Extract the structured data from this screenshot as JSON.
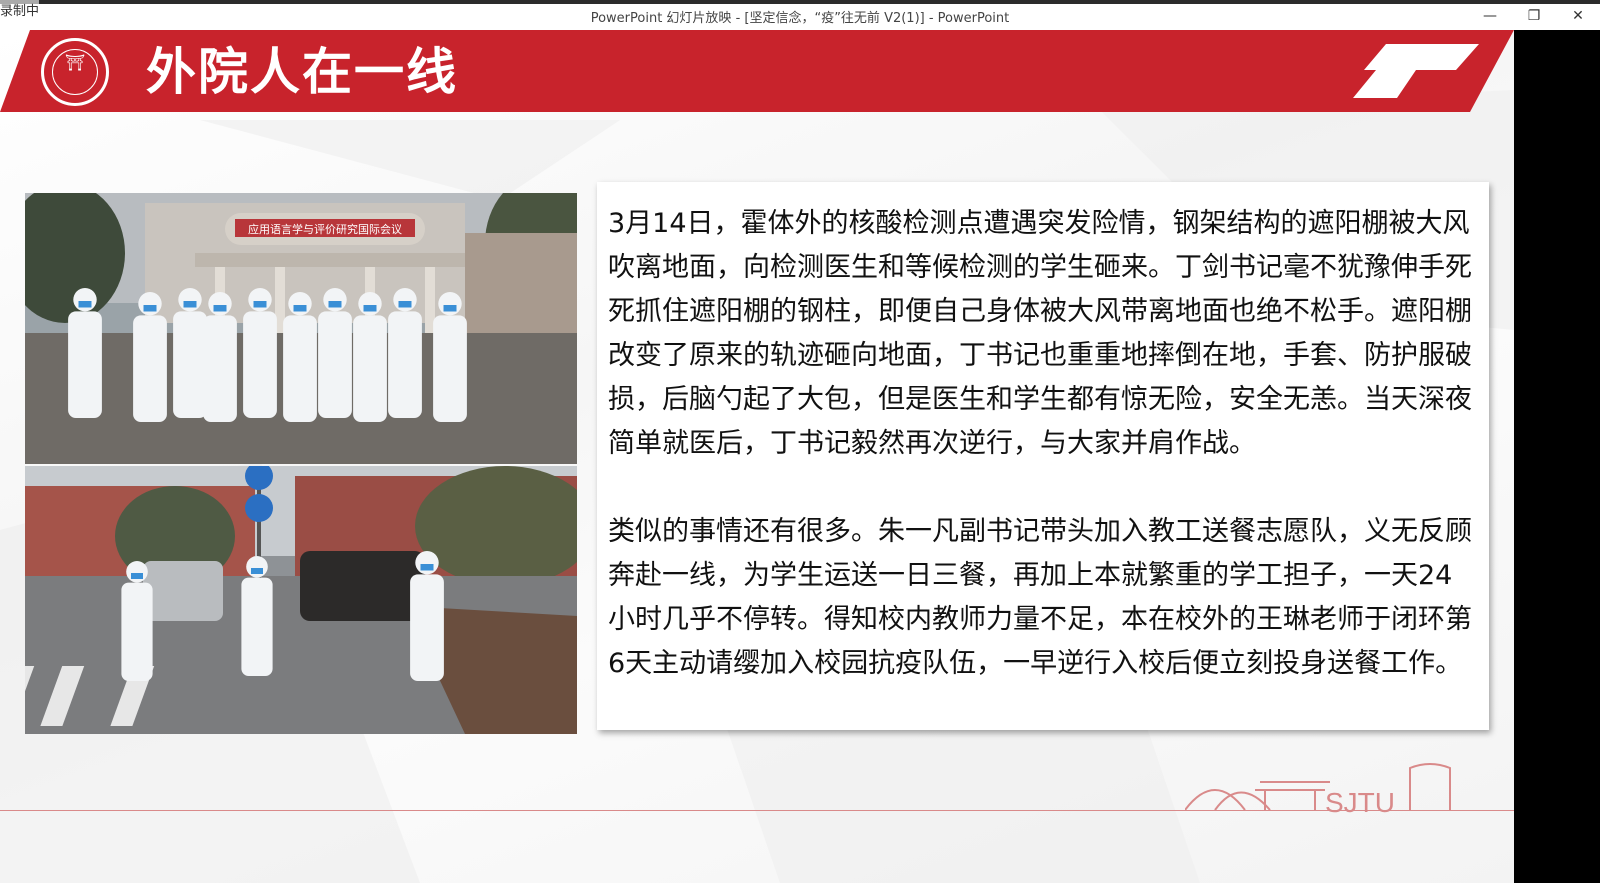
{
  "window": {
    "title": "PowerPoint 幻灯片放映 - [坚定信念，“疫”往无前 V2(1)] - PowerPoint",
    "recording_label": "录制中",
    "minimize": "—",
    "restore": "❐",
    "close": "✕"
  },
  "slide": {
    "title": "外院人在一线",
    "paragraph1": "3月14日，霍体外的核酸检测点遭遇突发险情，钢架结构的遮阳棚被大风吹离地面，向检测医生和等候检测的学生砸来。丁剑书记毫不犹豫伸手死死抓住遮阳棚的钢柱，即便自己身体被大风带离地面也绝不松手。遮阳棚改变了原来的轨迹砸向地面，丁书记也重重地摔倒在地，手套、防护服破损，后脑勺起了大包，但是医生和学生都有惊无险，安全无恙。当天深夜简单就医后，丁书记毅然再次逆行，与大家并肩作战。",
    "paragraph2": "类似的事情还有很多。朱一凡副书记带头加入教工送餐志愿队，义无反顾奔赴一线，为学生运送一日三餐，再加上本就繁重的学工担子，一天24小时几乎不停转。得知校内教师力量不足，本在校外的王琳老师于闭环第6天主动请缨加入校园抗疫队伍，一早逆行入校后便立刻投身送餐工作。",
    "photo1_banner": "应用语言学与评价研究国际会议",
    "footer_logo_text": "SJTU"
  },
  "colors": {
    "brand_red": "#c8232c",
    "ppe_white": "#f2f4f6",
    "mask_blue": "#3a8fd6"
  }
}
